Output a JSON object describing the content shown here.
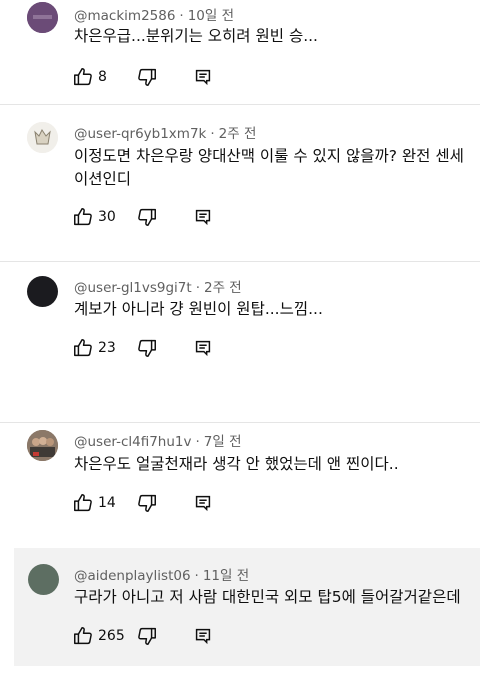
{
  "comments": [
    {
      "handle": "@mackim2586",
      "time": "10일 전",
      "lines": [
        "차은우급...분위기는 오히려 원빈 승..."
      ],
      "likes": "8"
    },
    {
      "handle": "@user-qr6yb1xm7k",
      "time": "2주 전",
      "lines": [
        "이정도면 차은우랑 양대산맥 이룰 수 있지 않을까? 완전 센세",
        "이션인디"
      ],
      "likes": "30"
    },
    {
      "handle": "@user-gl1vs9gi7t",
      "time": "2주 전",
      "lines": [
        "계보가 아니라 걍 원빈이 원탑...느낌..."
      ],
      "likes": "23"
    },
    {
      "handle": "@user-cl4fi7hu1v",
      "time": "7일 전",
      "lines": [
        "차은우도 얼굴천재라 생각 안 했었는데 앤 찐이다.."
      ],
      "likes": "14"
    },
    {
      "handle": "@aidenplaylist06",
      "time": "11일 전",
      "lines": [
        "구라가 아니고 저 사람 대한민국 외모 탑5에 들어갈거같은데"
      ],
      "likes": "265"
    }
  ],
  "colors": {
    "meta": "#606060",
    "text": "#0f0f0f",
    "highlight_bg": "#f2f2f2",
    "divider": "#e5e5e5"
  },
  "icons": {
    "like": "thumbs-up-icon",
    "dislike": "thumbs-down-icon",
    "reply": "reply-icon"
  }
}
